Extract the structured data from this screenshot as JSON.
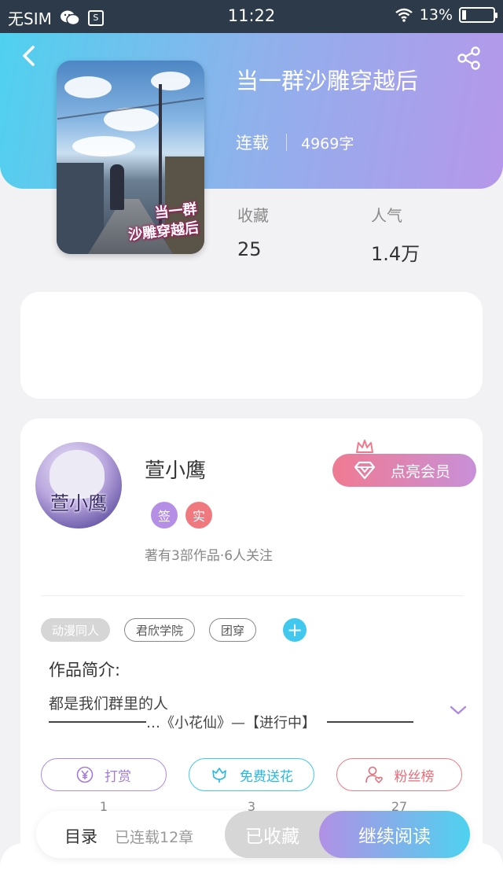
{
  "status_bar": {
    "carrier": "无SIM",
    "time": "11:22",
    "battery": "13%",
    "battery_level": 0.13,
    "icons": [
      "wechat-icon",
      "app-s-icon",
      "wifi-icon",
      "battery-icon"
    ]
  },
  "header": {
    "back_icon": "chevron-left-icon",
    "share_icon": "share-icon",
    "colors": {
      "gradient_start": "#4fd1ef",
      "gradient_end": "#b697ea"
    }
  },
  "book": {
    "cover_text_line1": "当一群",
    "cover_text_line2": "沙雕穿越后",
    "title": "当一群沙雕穿越后",
    "status": "连载",
    "word_count": "4969字",
    "stats": [
      {
        "label": "收藏",
        "value": "25"
      },
      {
        "label": "人气",
        "value": "1.4万"
      }
    ]
  },
  "author": {
    "avatar_text": "萱小鹰",
    "name": "萱小鹰",
    "badges": {
      "signed": "签",
      "verified": "实"
    },
    "summary": "著有3部作品·6人关注",
    "vip_button": "点亮会员"
  },
  "tags": {
    "items": [
      "动漫同人",
      "君欣学院",
      "团穿"
    ],
    "add_icon": "plus-icon",
    "add_label": "+"
  },
  "intro": {
    "label": "作品简介:",
    "line1": "都是我们群里的人",
    "line2_prefix": "…《小花仙》—【进行中】",
    "expand_icon": "chevron-down-icon"
  },
  "actions": [
    {
      "label": "打赏",
      "icon": "yen-coin-icon",
      "count": "1",
      "color": "#a47ad9"
    },
    {
      "label": "免费送花",
      "icon": "flower-icon",
      "count": "3",
      "color": "#26b8e4"
    },
    {
      "label": "粉丝榜",
      "icon": "user-heart-icon",
      "count": "27",
      "color": "#e86b77"
    }
  ],
  "footer": {
    "toc_label": "目录",
    "toc_count": "已连载12章",
    "collected_label": "已收藏",
    "read_label": "继续阅读"
  }
}
